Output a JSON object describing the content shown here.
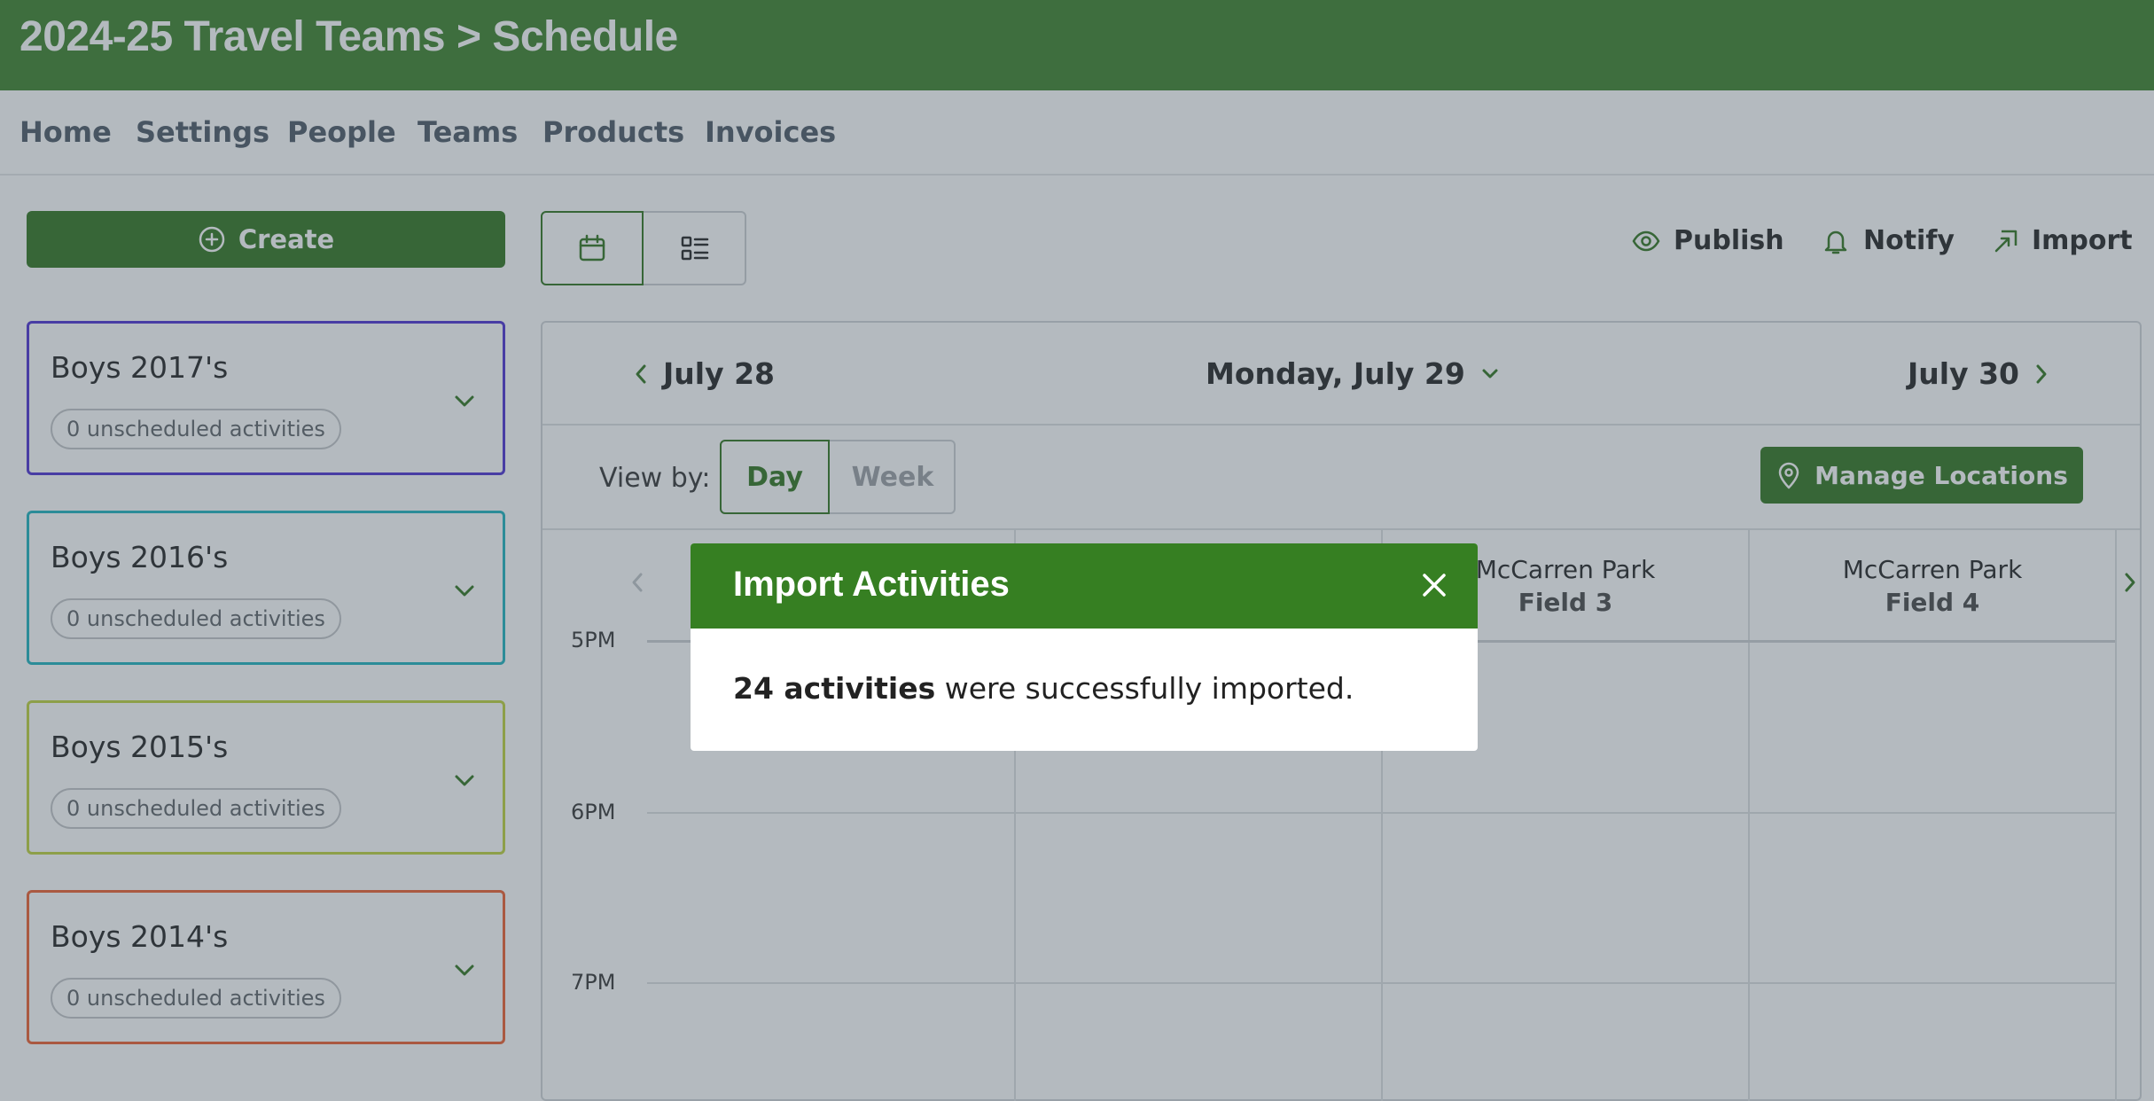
{
  "header": {
    "title": "2024-25 Travel Teams > Schedule"
  },
  "nav": {
    "items": [
      "Home",
      "Settings",
      "People",
      "Teams",
      "Products",
      "Invoices"
    ]
  },
  "sidebar": {
    "create_label": "Create",
    "teams": [
      {
        "name": "Boys 2017's",
        "unscheduled": "0 unscheduled activities",
        "color": "#5a3fd6"
      },
      {
        "name": "Boys 2016's",
        "unscheduled": "0 unscheduled activities",
        "color": "#2fb8c4"
      },
      {
        "name": "Boys 2015's",
        "unscheduled": "0 unscheduled activities",
        "color": "#c3d64a"
      },
      {
        "name": "Boys 2014's",
        "unscheduled": "0 unscheduled activities",
        "color": "#f06a3e"
      }
    ]
  },
  "toolbar": {
    "publish": "Publish",
    "notify": "Notify",
    "import": "Import"
  },
  "calendar": {
    "prev_date": "July 28",
    "current_date": "Monday, July 29",
    "next_date": "July 30",
    "view_by_label": "View by:",
    "view_day": "Day",
    "view_week": "Week",
    "manage_locations": "Manage Locations",
    "columns": [
      {
        "park": "McCarren Park",
        "field": "Field 3"
      },
      {
        "park": "McCarren Park",
        "field": "Field 4"
      }
    ],
    "times": [
      "5PM",
      "6PM",
      "7PM"
    ]
  },
  "modal": {
    "title": "Import Activities",
    "count_text": "24 activities",
    "message": " were successfully imported."
  },
  "colors": {
    "brand_green": "#3f7f2f",
    "header_green": "#4a8a3a"
  }
}
